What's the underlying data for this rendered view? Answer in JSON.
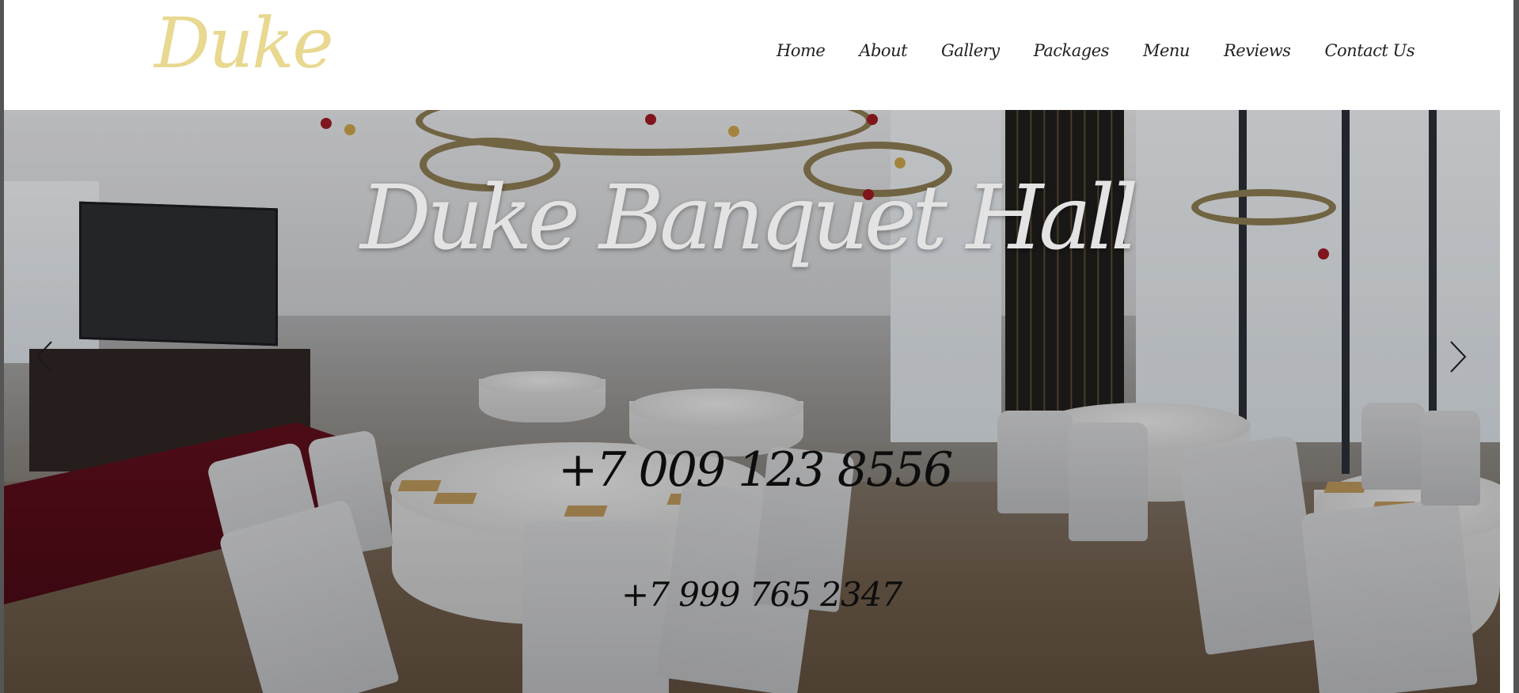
{
  "header": {
    "logo": "Duke",
    "logo_color": "#e8d890",
    "nav": {
      "home": "Home",
      "about": "About",
      "gallery": "Gallery",
      "packages": "Packages",
      "menu": "Menu",
      "reviews": "Reviews",
      "contact": "Contact Us"
    }
  },
  "hero": {
    "title": "Duke Banquet Hall",
    "phone_primary": "+7 009 123 8556",
    "phone_secondary": "+7 999 765 2347",
    "prev_icon": "chevron-left-icon",
    "next_icon": "chevron-right-icon"
  }
}
